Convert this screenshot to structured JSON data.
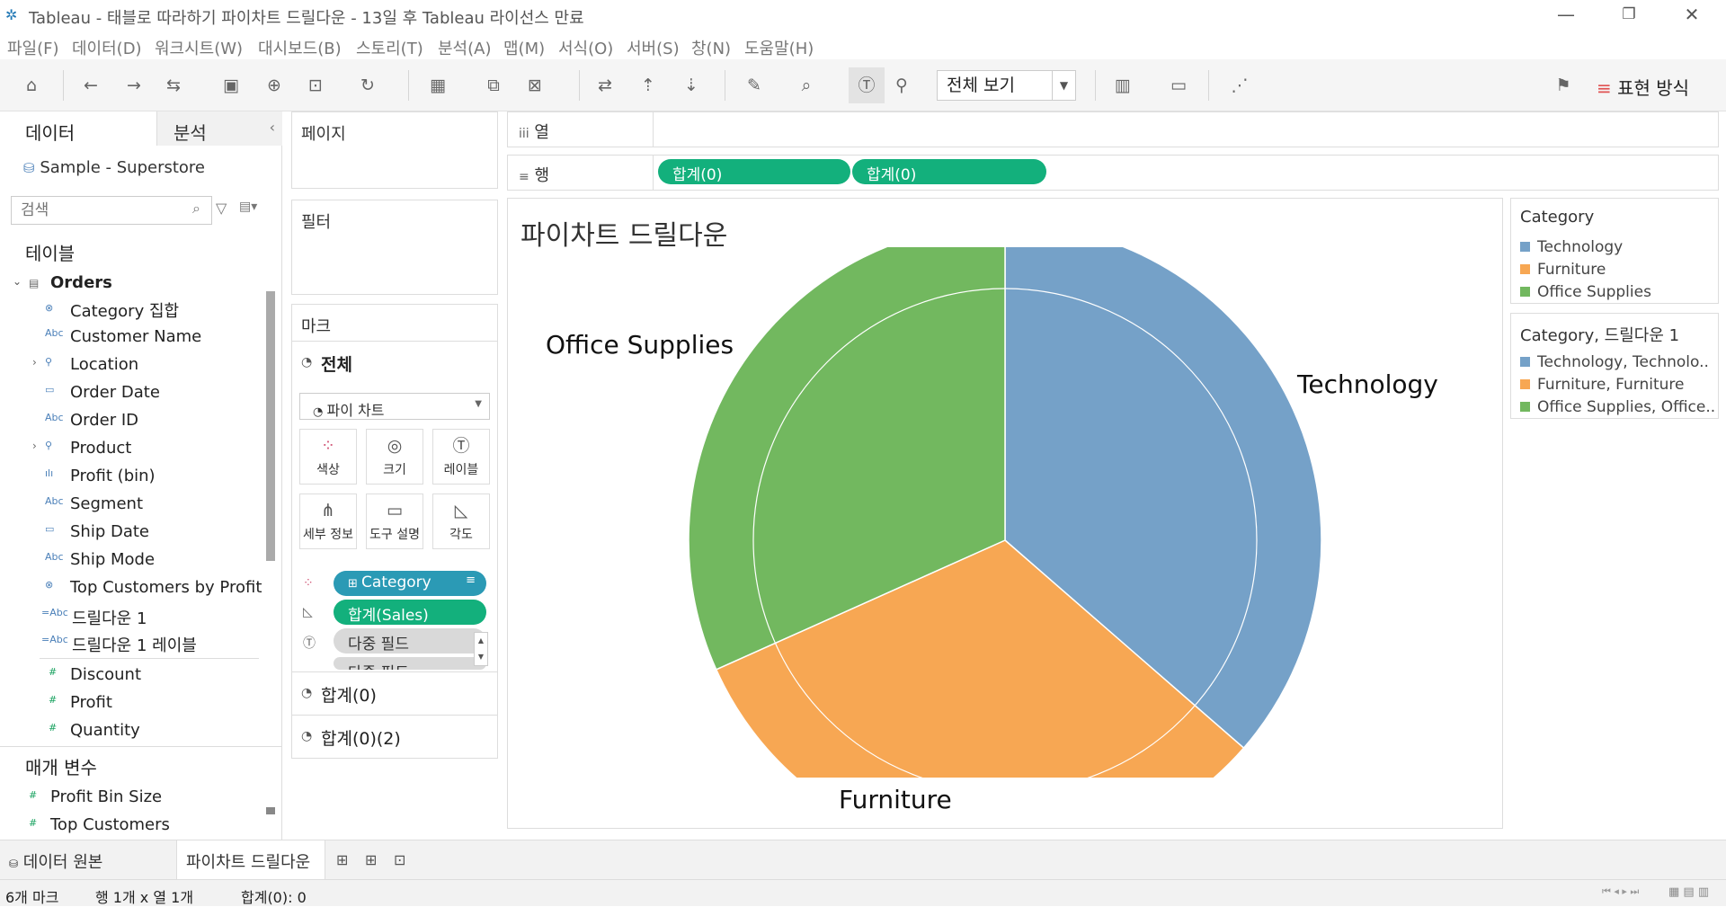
{
  "window": {
    "title": "Tableau - 태블로 따라하기 파이차트 드릴다운 - 13일 후 Tableau 라이선스 만료"
  },
  "menu": [
    "파일(F)",
    "데이터(D)",
    "워크시트(W)",
    "대시보드(B)",
    "스토리(T)",
    "분석(A)",
    "맵(M)",
    "서식(O)",
    "서버(S)",
    "창(N)",
    "도움말(H)"
  ],
  "toolbar": {
    "view_select": "전체 보기",
    "format_label": "표현 방식"
  },
  "left": {
    "tab_data": "데이터",
    "tab_analysis": "분석",
    "source": "Sample - Superstore",
    "search_placeholder": "검색",
    "tables_header": "테이블",
    "table_name": "Orders",
    "dimensions": [
      "Category 집합",
      "Customer Name",
      "Location",
      "Order Date",
      "Order ID",
      "Product",
      "Profit (bin)",
      "Segment",
      "Ship Date",
      "Ship Mode",
      "Top Customers by Profit",
      "드릴다운 1",
      "드릴다운 1 레이블"
    ],
    "measures": [
      "Discount",
      "Profit",
      "Quantity"
    ],
    "params_header": "매개 변수",
    "params": [
      "Profit Bin Size",
      "Top Customers"
    ]
  },
  "shelves": {
    "pages": "페이지",
    "filters": "필터",
    "marks": "마크",
    "columns_label": "열",
    "rows_label": "행",
    "row_pills": [
      "합계(0)",
      "합계(0)"
    ]
  },
  "marks": {
    "all": "전체",
    "mark_type": "파이 차트",
    "buttons": [
      "색상",
      "크기",
      "레이블",
      "세부 정보",
      "도구 설명",
      "각도"
    ],
    "pills": [
      "Category",
      "합계(Sales)",
      "다중 필드",
      "다중 필드"
    ],
    "sub1": "합계(0)",
    "sub2": "합계(0)(2)"
  },
  "view": {
    "title": "파이차트 드릴다운",
    "labels": {
      "office": "Office Supplies",
      "tech": "Technology",
      "furn": "Furniture"
    }
  },
  "legend1": {
    "title": "Category",
    "items": [
      "Technology",
      "Furniture",
      "Office Supplies"
    ]
  },
  "legend2": {
    "title": "Category, 드릴다운 1",
    "items": [
      "Technology, Technolo..",
      "Furniture, Furniture",
      "Office Supplies, Office.."
    ]
  },
  "colors": {
    "technology": "#75a1c8",
    "furniture": "#f7a753",
    "office": "#72b85f",
    "pill": "#13b07c",
    "pill_blue": "#2b9ab5"
  },
  "chart_data": {
    "type": "pie",
    "title": "파이차트 드릴다운",
    "categories": [
      "Technology",
      "Furniture",
      "Office Supplies"
    ],
    "values": [
      36.4,
      31.9,
      31.7
    ],
    "legend_placement": "right"
  },
  "bottom": {
    "data_source_tab": "데이터 원본",
    "sheet_tab": "파이차트 드릴다운"
  },
  "status": {
    "marks": "6개 마크",
    "rows_cols": "행 1개 x 열 1개",
    "sum": "합계(0): 0"
  }
}
